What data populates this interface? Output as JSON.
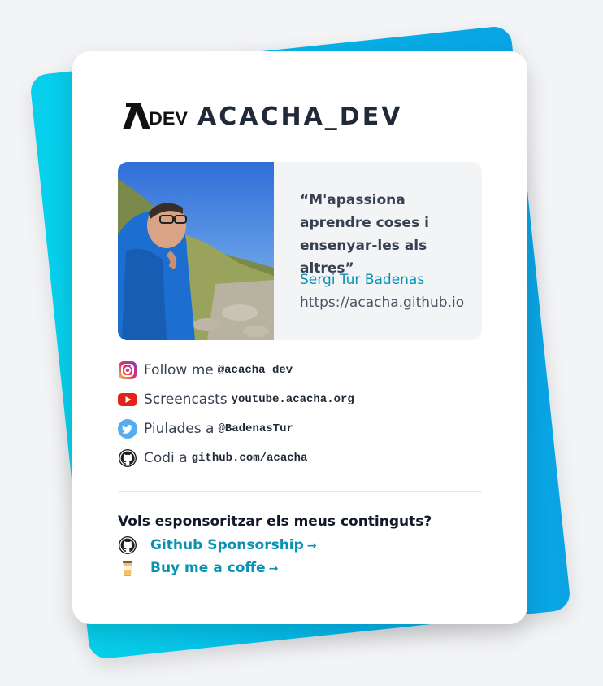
{
  "brand": {
    "logo_alt": "ADEV",
    "title": "ACACHA_DEV"
  },
  "profile": {
    "quote": "“M'apassiona aprendre coses i ensenyar-les als altres”",
    "author": "Sergi Tur Badenas",
    "website": "https://acacha.github.io"
  },
  "socials": [
    {
      "icon": "instagram-icon",
      "label": "Follow me",
      "handle": "@acacha_dev"
    },
    {
      "icon": "youtube-icon",
      "label": "Screencasts",
      "handle": "youtube.acacha.org"
    },
    {
      "icon": "twitter-icon",
      "label": "Piulades a",
      "handle": "@BadenasTur"
    },
    {
      "icon": "github-icon",
      "label": "Codi a",
      "handle": "github.com/acacha"
    }
  ],
  "sponsor": {
    "heading": "Vols esponsoritzar els meus continguts?",
    "links": [
      {
        "icon": "github-icon",
        "label": "Github Sponsorship",
        "arrow": "→"
      },
      {
        "icon": "coffee-cup-icon",
        "label": "Buy me a coffe",
        "arrow": "→"
      }
    ]
  },
  "colors": {
    "accent": "#0891b2",
    "backdrop": "#05b4e8"
  }
}
